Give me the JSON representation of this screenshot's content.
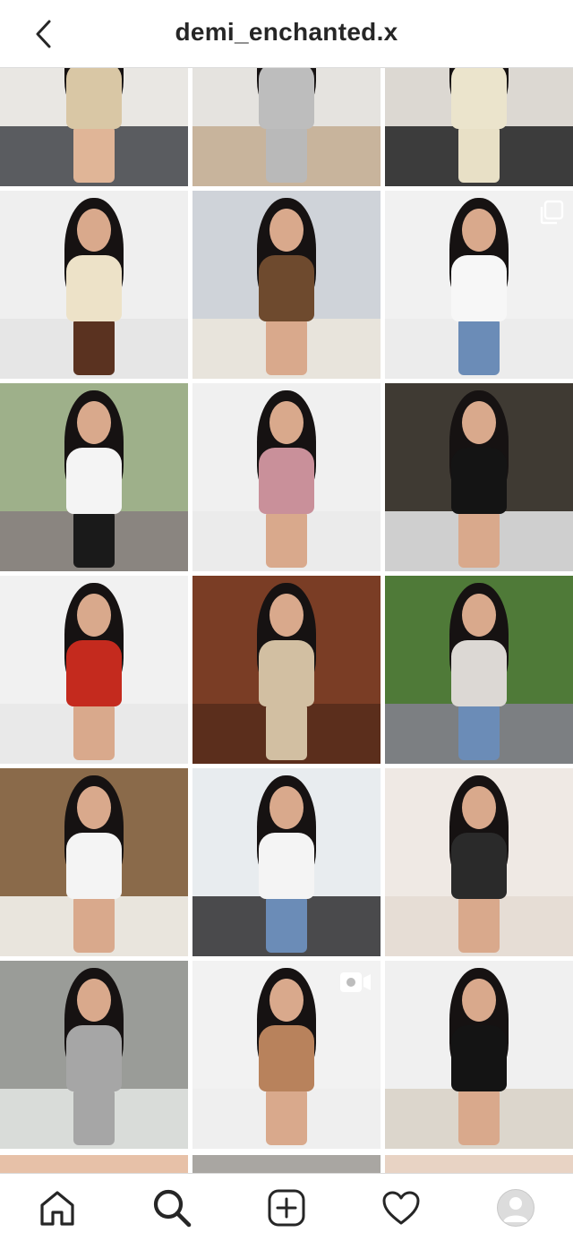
{
  "header": {
    "username": "demi_enchanted.x",
    "back_icon": "chevron-left-icon"
  },
  "grid": {
    "columns": 3,
    "posts": [
      {
        "scene": "room-beige-dress",
        "wall": "#e9e7e3",
        "floor": "#5a5c60",
        "outfit": "#d9c7a5",
        "legs": "#e0b597",
        "badge": "none"
      },
      {
        "scene": "kitchen-grey-set",
        "wall": "#e5e3df",
        "floor": "#c8b49c",
        "outfit": "#bdbdbd",
        "legs": "#b9b9b9",
        "badge": "none"
      },
      {
        "scene": "balcony-cream-set",
        "wall": "#dcd8d2",
        "floor": "#3c3c3c",
        "outfit": "#ebe4cc",
        "legs": "#e8e0c6",
        "badge": "none"
      },
      {
        "scene": "studio-cream-top",
        "wall": "#efefef",
        "floor": "#e6e6e6",
        "outfit": "#ede2c8",
        "legs": "#5a3220",
        "badge": "none"
      },
      {
        "scene": "sofa-brown-set",
        "wall": "#cfd3d9",
        "floor": "#e8e4dc",
        "outfit": "#6e4a2e",
        "legs": "#d9a98c",
        "badge": "none"
      },
      {
        "scene": "studio-white-corset",
        "wall": "#f1f1f1",
        "floor": "#ececec",
        "outfit": "#f7f7f7",
        "legs": "#6b8cb7",
        "badge": "carousel-icon"
      },
      {
        "scene": "park-white-dress",
        "wall": "#9eb08a",
        "floor": "#8a8580",
        "outfit": "#f4f4f4",
        "legs": "#1a1a1a",
        "badge": "none"
      },
      {
        "scene": "studio-pink-dress",
        "wall": "#f0f0f0",
        "floor": "#ebebeb",
        "outfit": "#c9909a",
        "legs": "#d9a98c",
        "badge": "none"
      },
      {
        "scene": "restaurant-black-top",
        "wall": "#3f3a33",
        "floor": "#cfcfcf",
        "outfit": "#141414",
        "legs": "#d9a98c",
        "badge": "none"
      },
      {
        "scene": "studio-red-robe",
        "wall": "#f1f1f1",
        "floor": "#e9e9e9",
        "outfit": "#c42a1e",
        "legs": "#d9a98c",
        "badge": "none"
      },
      {
        "scene": "room-beige-tshirt",
        "wall": "#7a3d25",
        "floor": "#5b2e1c",
        "outfit": "#d2bfa2",
        "legs": "#d2bfa2",
        "badge": "none"
      },
      {
        "scene": "garden-white-jacket",
        "wall": "#4f7a38",
        "floor": "#7c7f82",
        "outfit": "#dcd8d4",
        "legs": "#6b8cb7",
        "badge": "none"
      },
      {
        "scene": "restaurant-pasta",
        "wall": "#8a6a4a",
        "floor": "#e9e5dd",
        "outfit": "#f4f4f4",
        "legs": "#d9a98c",
        "badge": "none"
      },
      {
        "scene": "street-new-york",
        "wall": "#e8ecef",
        "floor": "#4a4a4c",
        "outfit": "#f4f4f4",
        "legs": "#6b8cb7",
        "badge": "none"
      },
      {
        "scene": "selfie-wine-glass",
        "wall": "#efe9e4",
        "floor": "#e6ddd5",
        "outfit": "#2a2a2a",
        "legs": "#d9a98c",
        "badge": "none"
      },
      {
        "scene": "snow-park-grey-set",
        "wall": "#9a9c98",
        "floor": "#d9dcd9",
        "outfit": "#a6a6a6",
        "legs": "#a6a6a6",
        "badge": "none"
      },
      {
        "scene": "selfie-brown-shirt",
        "wall": "#f2f2f2",
        "floor": "#efefef",
        "outfit": "#b8825c",
        "legs": "#d9a98c",
        "badge": "video-icon"
      },
      {
        "scene": "kitchen-black-set",
        "wall": "#f0f0f0",
        "floor": "#dcd6cc",
        "outfit": "#141414",
        "legs": "#d9a98c",
        "badge": "none"
      }
    ],
    "partial_row": [
      {
        "color": "#e7c1a8"
      },
      {
        "color": "#a9a6a2"
      },
      {
        "color": "#e8d3c4"
      }
    ]
  },
  "bottom_nav": {
    "items": [
      {
        "name": "home",
        "icon": "home-icon"
      },
      {
        "name": "search",
        "icon": "search-icon"
      },
      {
        "name": "new-post",
        "icon": "add-post-icon"
      },
      {
        "name": "activity",
        "icon": "heart-icon"
      },
      {
        "name": "profile",
        "icon": "avatar-icon"
      }
    ]
  }
}
